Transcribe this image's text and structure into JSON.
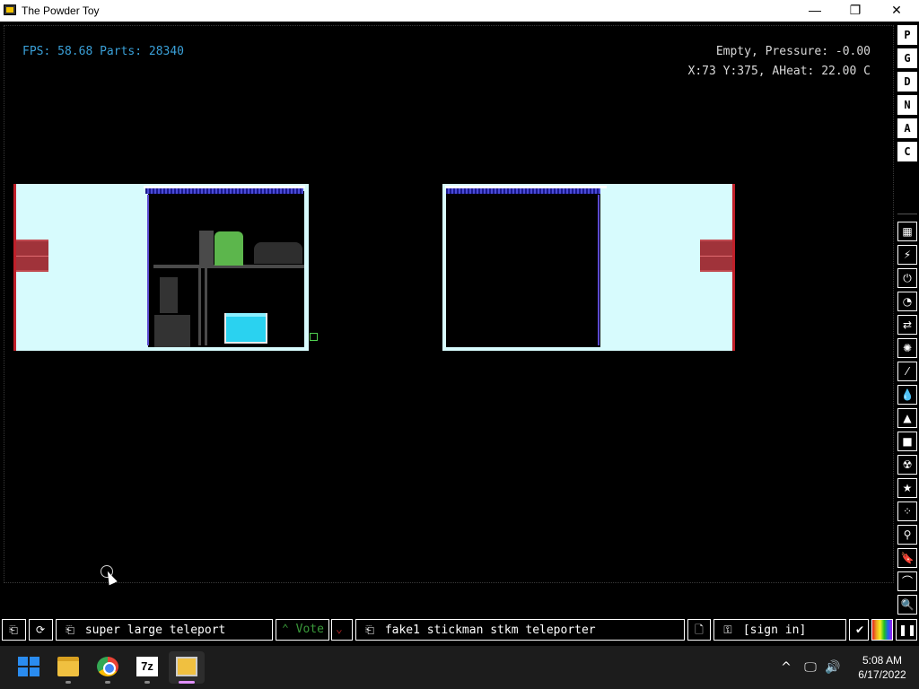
{
  "window": {
    "title": "The Powder Toy",
    "minimize_glyph": "—",
    "maximize_glyph": "❐",
    "close_glyph": "✕"
  },
  "hud": {
    "fps_parts": "FPS: 58.68 Parts: 28340",
    "status_line1": "Empty, Pressure: -0.00",
    "status_line2": "X:73 Y:375, AHeat: 22.00 C"
  },
  "sidebar": {
    "letters": [
      "P",
      "G",
      "D",
      "N",
      "A",
      "C"
    ],
    "categories": [
      {
        "name": "walls-icon",
        "glyph": "▦"
      },
      {
        "name": "electronics-icon",
        "glyph": "⚡"
      },
      {
        "name": "powered-icon",
        "glyph": "⏻"
      },
      {
        "name": "sensors-icon",
        "glyph": "◔"
      },
      {
        "name": "force-icon",
        "glyph": "⇄"
      },
      {
        "name": "explosives-icon",
        "glyph": "✺"
      },
      {
        "name": "gases-icon",
        "glyph": "⁄"
      },
      {
        "name": "liquids-icon",
        "glyph": "💧"
      },
      {
        "name": "powders-icon",
        "glyph": "▲"
      },
      {
        "name": "solids-icon",
        "glyph": "■"
      },
      {
        "name": "radioactive-icon",
        "glyph": "☢"
      },
      {
        "name": "special-icon",
        "glyph": "★"
      },
      {
        "name": "life-icon",
        "glyph": "⁘"
      },
      {
        "name": "tools-icon",
        "glyph": "⚲"
      },
      {
        "name": "favorites-icon",
        "glyph": "🔖"
      },
      {
        "name": "recent-icon",
        "glyph": "⌒"
      },
      {
        "name": "search-icon",
        "glyph": "🔍"
      }
    ]
  },
  "bottombar": {
    "open_glyph": "⎗",
    "reload_glyph": "⟳",
    "save_name": "super large teleport",
    "vote_label": "Vote",
    "vote_up_glyph": "⌃",
    "vote_down_glyph": "⌄",
    "tags": "fake1 stickman stkm teleporter",
    "new_glyph": "🗋",
    "login_label": "[sign in]",
    "render_glyph": "✔",
    "pause_glyph": "❚❚"
  },
  "taskbar": {
    "sevenzip_label": "7z",
    "time": "5:08 AM",
    "date": "6/17/2022",
    "tray_chevron": "^",
    "tray_network": "🖵",
    "tray_volume": "🔊"
  }
}
